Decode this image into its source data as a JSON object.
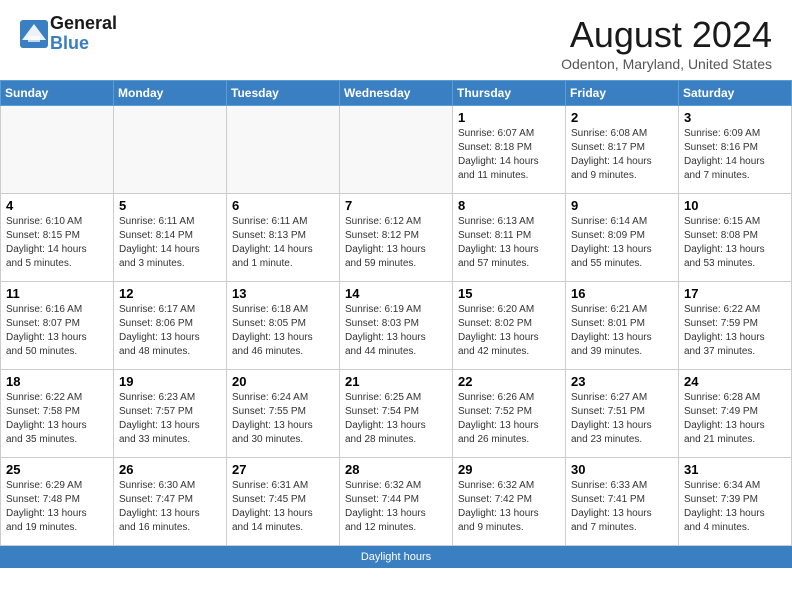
{
  "header": {
    "logo_line1": "General",
    "logo_line2": "Blue",
    "month_title": "August 2024",
    "location": "Odenton, Maryland, United States"
  },
  "days_of_week": [
    "Sunday",
    "Monday",
    "Tuesday",
    "Wednesday",
    "Thursday",
    "Friday",
    "Saturday"
  ],
  "footer": {
    "text": "Daylight hours"
  },
  "weeks": [
    [
      {
        "day": "",
        "info": ""
      },
      {
        "day": "",
        "info": ""
      },
      {
        "day": "",
        "info": ""
      },
      {
        "day": "",
        "info": ""
      },
      {
        "day": "1",
        "info": "Sunrise: 6:07 AM\nSunset: 8:18 PM\nDaylight: 14 hours\nand 11 minutes."
      },
      {
        "day": "2",
        "info": "Sunrise: 6:08 AM\nSunset: 8:17 PM\nDaylight: 14 hours\nand 9 minutes."
      },
      {
        "day": "3",
        "info": "Sunrise: 6:09 AM\nSunset: 8:16 PM\nDaylight: 14 hours\nand 7 minutes."
      }
    ],
    [
      {
        "day": "4",
        "info": "Sunrise: 6:10 AM\nSunset: 8:15 PM\nDaylight: 14 hours\nand 5 minutes."
      },
      {
        "day": "5",
        "info": "Sunrise: 6:11 AM\nSunset: 8:14 PM\nDaylight: 14 hours\nand 3 minutes."
      },
      {
        "day": "6",
        "info": "Sunrise: 6:11 AM\nSunset: 8:13 PM\nDaylight: 14 hours\nand 1 minute."
      },
      {
        "day": "7",
        "info": "Sunrise: 6:12 AM\nSunset: 8:12 PM\nDaylight: 13 hours\nand 59 minutes."
      },
      {
        "day": "8",
        "info": "Sunrise: 6:13 AM\nSunset: 8:11 PM\nDaylight: 13 hours\nand 57 minutes."
      },
      {
        "day": "9",
        "info": "Sunrise: 6:14 AM\nSunset: 8:09 PM\nDaylight: 13 hours\nand 55 minutes."
      },
      {
        "day": "10",
        "info": "Sunrise: 6:15 AM\nSunset: 8:08 PM\nDaylight: 13 hours\nand 53 minutes."
      }
    ],
    [
      {
        "day": "11",
        "info": "Sunrise: 6:16 AM\nSunset: 8:07 PM\nDaylight: 13 hours\nand 50 minutes."
      },
      {
        "day": "12",
        "info": "Sunrise: 6:17 AM\nSunset: 8:06 PM\nDaylight: 13 hours\nand 48 minutes."
      },
      {
        "day": "13",
        "info": "Sunrise: 6:18 AM\nSunset: 8:05 PM\nDaylight: 13 hours\nand 46 minutes."
      },
      {
        "day": "14",
        "info": "Sunrise: 6:19 AM\nSunset: 8:03 PM\nDaylight: 13 hours\nand 44 minutes."
      },
      {
        "day": "15",
        "info": "Sunrise: 6:20 AM\nSunset: 8:02 PM\nDaylight: 13 hours\nand 42 minutes."
      },
      {
        "day": "16",
        "info": "Sunrise: 6:21 AM\nSunset: 8:01 PM\nDaylight: 13 hours\nand 39 minutes."
      },
      {
        "day": "17",
        "info": "Sunrise: 6:22 AM\nSunset: 7:59 PM\nDaylight: 13 hours\nand 37 minutes."
      }
    ],
    [
      {
        "day": "18",
        "info": "Sunrise: 6:22 AM\nSunset: 7:58 PM\nDaylight: 13 hours\nand 35 minutes."
      },
      {
        "day": "19",
        "info": "Sunrise: 6:23 AM\nSunset: 7:57 PM\nDaylight: 13 hours\nand 33 minutes."
      },
      {
        "day": "20",
        "info": "Sunrise: 6:24 AM\nSunset: 7:55 PM\nDaylight: 13 hours\nand 30 minutes."
      },
      {
        "day": "21",
        "info": "Sunrise: 6:25 AM\nSunset: 7:54 PM\nDaylight: 13 hours\nand 28 minutes."
      },
      {
        "day": "22",
        "info": "Sunrise: 6:26 AM\nSunset: 7:52 PM\nDaylight: 13 hours\nand 26 minutes."
      },
      {
        "day": "23",
        "info": "Sunrise: 6:27 AM\nSunset: 7:51 PM\nDaylight: 13 hours\nand 23 minutes."
      },
      {
        "day": "24",
        "info": "Sunrise: 6:28 AM\nSunset: 7:49 PM\nDaylight: 13 hours\nand 21 minutes."
      }
    ],
    [
      {
        "day": "25",
        "info": "Sunrise: 6:29 AM\nSunset: 7:48 PM\nDaylight: 13 hours\nand 19 minutes."
      },
      {
        "day": "26",
        "info": "Sunrise: 6:30 AM\nSunset: 7:47 PM\nDaylight: 13 hours\nand 16 minutes."
      },
      {
        "day": "27",
        "info": "Sunrise: 6:31 AM\nSunset: 7:45 PM\nDaylight: 13 hours\nand 14 minutes."
      },
      {
        "day": "28",
        "info": "Sunrise: 6:32 AM\nSunset: 7:44 PM\nDaylight: 13 hours\nand 12 minutes."
      },
      {
        "day": "29",
        "info": "Sunrise: 6:32 AM\nSunset: 7:42 PM\nDaylight: 13 hours\nand 9 minutes."
      },
      {
        "day": "30",
        "info": "Sunrise: 6:33 AM\nSunset: 7:41 PM\nDaylight: 13 hours\nand 7 minutes."
      },
      {
        "day": "31",
        "info": "Sunrise: 6:34 AM\nSunset: 7:39 PM\nDaylight: 13 hours\nand 4 minutes."
      }
    ]
  ]
}
